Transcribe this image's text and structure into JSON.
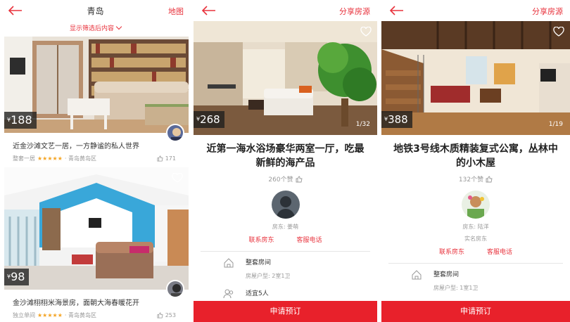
{
  "list_screen": {
    "title": "青岛",
    "map_label": "地图",
    "filter_label": "显示筛选后内容",
    "listings": [
      {
        "price_currency": "¥",
        "price": "188",
        "title": "近金沙滩文艺一居，一方静谧的私人世界",
        "type": "整套一居",
        "stars": "★★★★★",
        "location": "青岛黄岛区",
        "likes": "171"
      },
      {
        "price_currency": "¥",
        "price": "98",
        "title": "金沙滩栩栩米海景房，面朝大海春暖花开",
        "type": "独立单间",
        "stars": "★★★★★",
        "location": "青岛黄岛区",
        "likes": "253"
      }
    ]
  },
  "detail_a": {
    "share_label": "分享房源",
    "price_currency": "¥",
    "price": "268",
    "photo_counter": "1/32",
    "title": "近第一海水浴场豪华两室一厅，吃最新鲜的海产品",
    "likes": "260个赞",
    "host": "房东: 姜萌",
    "contact_host": "联系房东",
    "service_phone": "客服电话",
    "facility_1_title": "整套房间",
    "facility_1_sub": "房屋户型: 2室1卫",
    "facility_2_title": "适宜5人",
    "book_label": "申请预订"
  },
  "detail_b": {
    "share_label": "分享房源",
    "price_currency": "¥",
    "price": "388",
    "photo_counter": "1/19",
    "title": "地铁3号线木质精装复式公寓，丛林中的小木屋",
    "likes": "132个赞",
    "host": "房东: 陆洋",
    "verified": "实名房东",
    "contact_host": "联系房东",
    "service_phone": "客服电话",
    "facility_1_title": "整套房间",
    "facility_1_sub": "房屋户型: 1室1卫",
    "book_label": "申请预订"
  },
  "colors": {
    "accent": "#e8323c",
    "book_bar": "#e8212b",
    "star": "#f4a423"
  }
}
